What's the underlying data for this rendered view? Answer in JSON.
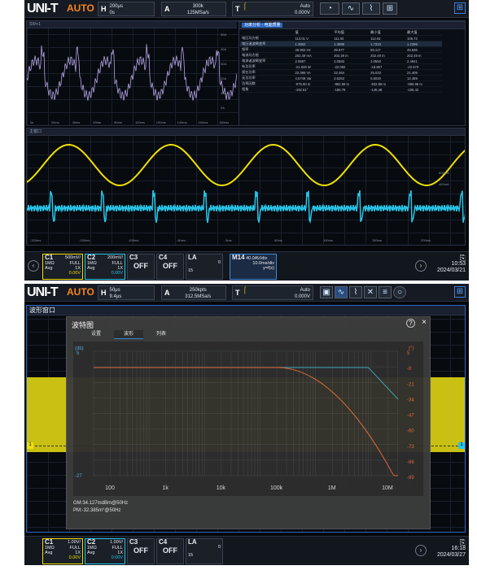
{
  "screen1": {
    "topbar": {
      "logo": "UNI-T",
      "mode": "AUTO",
      "h_label": "H",
      "h_top": "200μs",
      "h_bottom": "0s",
      "a_label": "A",
      "a_top": "300k",
      "a_bottom": "125MSa/s",
      "t_label": "T",
      "trig_mode": "Auto",
      "trig_level": "0.000V",
      "trig_ch": "1"
    },
    "power_window": {
      "tab": "功率分析 - 电能质量",
      "title": "SW+1"
    },
    "table": {
      "headers": [
        "",
        "值",
        "平均值",
        "最小值",
        "最大值"
      ],
      "rows": [
        [
          "电压均方根",
          "113.01 V",
          "111.03",
          "112.62",
          "105.72"
        ],
        [
          "电压谐波畸变率",
          "1.3862",
          "1.3889",
          "1.7310",
          "1.2398"
        ],
        [
          "频率",
          "49.902 Hz",
          "49.977",
          "50.117",
          "49.836"
        ],
        [
          "电流均方根",
          "202.49 mA",
          "202.49 m",
          "202.49 m",
          "202.49 m"
        ],
        [
          "电流谐波畸变率",
          "2.0597",
          "2.0583",
          "2.0550",
          "2.4941"
        ],
        [
          "有功功率",
          "-21.639 W",
          "-22.092",
          "-18.807",
          "-22.673"
        ],
        [
          "视在功率",
          "22.398 VA",
          "22.484",
          "25.033",
          "21.409"
        ],
        [
          "无功功率",
          "4.5748 Var",
          "2.6253",
          "5.5020",
          "12.489"
        ],
        [
          "功率因数",
          "-975.90 m",
          "-982.59 m",
          "-832.98 m",
          "-996.96 m"
        ],
        [
          "相角",
          "-192.61°",
          "-188.78",
          "-146.48",
          "-195.42"
        ]
      ]
    },
    "top_axis": [
      "0s",
      "20ms",
      "40ms",
      "60ms",
      "80ms",
      "100ms",
      "120ms",
      "140ms",
      "160ms",
      "180ms"
    ],
    "left_scale": [
      "50A",
      "40A",
      "30A",
      "20A",
      "10A",
      "0A"
    ],
    "main_window_title": "主窗口",
    "main_axis": [
      "-200ms",
      "-150ms",
      "-100ms",
      "-50ms",
      "0ms",
      "50ms",
      "100ms",
      "150ms",
      "200ms"
    ],
    "main_scale": [
      "600mA",
      "400mA"
    ],
    "channels": [
      {
        "name": "C1",
        "value": "500mV/",
        "imp": "1MΩ",
        "bw": "FULL",
        "probe": "1X",
        "coupling": "Avg",
        "offset": "0.00V",
        "color": "#f0e000"
      },
      {
        "name": "C2",
        "value": "200mV/",
        "imp": "1MΩ",
        "bw": "FULL",
        "probe": "1X",
        "coupling": "Avg",
        "offset": "0.00V",
        "color": "#27c6e8"
      },
      {
        "name": "C3",
        "value": "OFF"
      },
      {
        "name": "C4",
        "value": "OFF"
      }
    ],
    "la": {
      "name": "LA",
      "top": "0",
      "bottom": "15"
    },
    "math": {
      "name": "M14",
      "line1": "40.0AV/div",
      "line2": "10.0ms/div",
      "line3": "y=f(x)"
    },
    "time": "10:53",
    "date": "2024/03/21"
  },
  "screen2": {
    "topbar": {
      "logo": "UNI-T",
      "mode": "AUTO",
      "h_label": "H",
      "h_top": "50μs",
      "h_bottom": "9.4μs",
      "a_label": "A",
      "a_top": "250kpts",
      "a_bottom": "312.5MSa/s",
      "t_label": "T",
      "trig_mode": "Auto",
      "trig_level": "0.000V",
      "trig_ch": "1"
    },
    "window_title": "波形窗口",
    "bode": {
      "title": "波特图",
      "tabs": [
        "设置",
        "波形",
        "列表"
      ],
      "active_tab": "波形",
      "y_left_unit": "(db)",
      "y_right_unit": "(°)",
      "y_left": [
        "5",
        "",
        "",
        "",
        "",
        "",
        "",
        "",
        "",
        "-27"
      ],
      "y_right": [
        "5",
        "-8",
        "-21",
        "-34",
        "-47",
        "-60",
        "-73",
        "-86",
        "-99"
      ],
      "x_ticks": [
        "100",
        "1k",
        "10k",
        "100k",
        "1M",
        "10M"
      ],
      "gm": "GM:34.127mdBm@50Hz",
      "pm": "PM:-32.385m°@50Hz"
    },
    "channels": [
      {
        "name": "C1",
        "value": "1.00V/",
        "imp": "1MΩ",
        "bw": "FULL",
        "probe": "1X",
        "coupling": "Avg",
        "offset": "0.00V"
      },
      {
        "name": "C2",
        "value": "1.00V/",
        "imp": "1MΩ",
        "bw": "FULL",
        "probe": "1X",
        "coupling": "Avg",
        "offset": "0.00V"
      },
      {
        "name": "C3",
        "value": "OFF"
      },
      {
        "name": "C4",
        "value": "OFF"
      }
    ],
    "la": {
      "name": "LA",
      "top": "0",
      "bottom": "15"
    },
    "time": "16:18",
    "date": "2024/03/27"
  },
  "colors": {
    "ch1": "#f0e000",
    "ch2": "#27c6e8",
    "math": "#b7a6e8",
    "accent": "#3a8bd8",
    "brand": "#f5831f"
  }
}
